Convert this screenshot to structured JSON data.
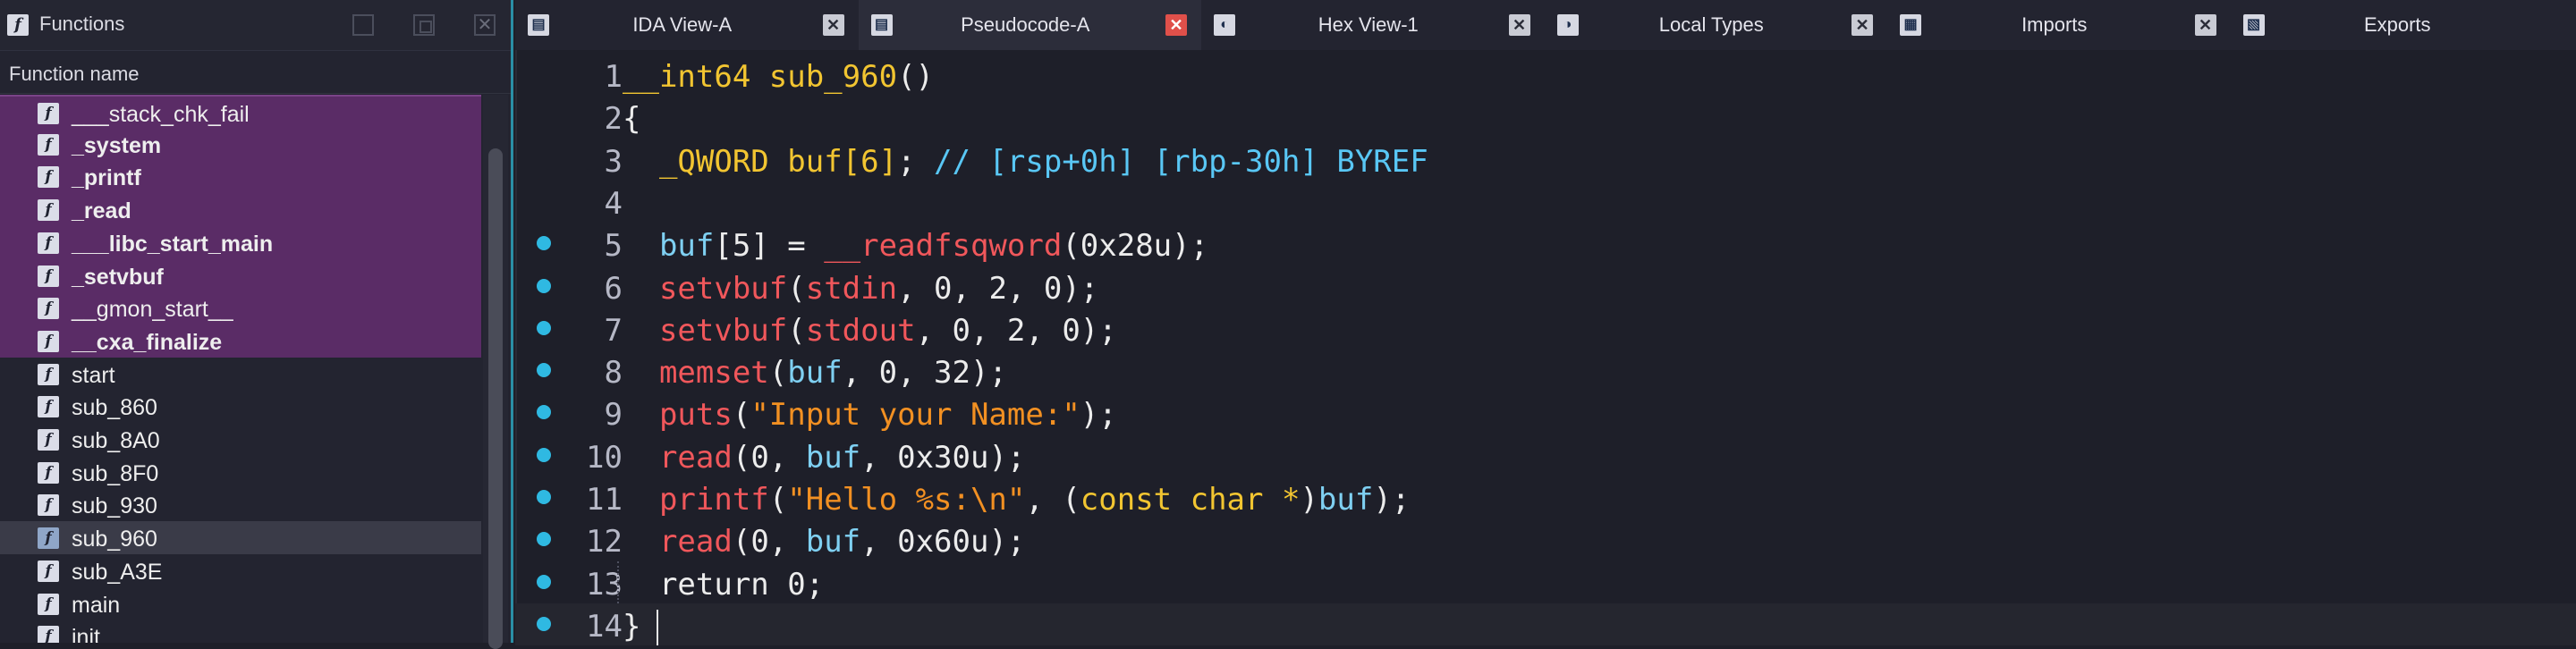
{
  "functions_panel": {
    "title": "Functions",
    "close_glyph": "✕",
    "column_header": "Function name",
    "icon_glyph": "f",
    "items": [
      {
        "name": "___stack_chk_fail",
        "imported": true,
        "bold": false
      },
      {
        "name": "_system",
        "imported": true,
        "bold": true
      },
      {
        "name": "_printf",
        "imported": true,
        "bold": true
      },
      {
        "name": "_read",
        "imported": true,
        "bold": true
      },
      {
        "name": "___libc_start_main",
        "imported": true,
        "bold": true
      },
      {
        "name": "_setvbuf",
        "imported": true,
        "bold": true
      },
      {
        "name": "__gmon_start__",
        "imported": true,
        "bold": false
      },
      {
        "name": "__cxa_finalize",
        "imported": true,
        "bold": true
      },
      {
        "name": "start",
        "imported": false,
        "bold": false
      },
      {
        "name": "sub_860",
        "imported": false,
        "bold": false
      },
      {
        "name": "sub_8A0",
        "imported": false,
        "bold": false
      },
      {
        "name": "sub_8F0",
        "imported": false,
        "bold": false
      },
      {
        "name": "sub_930",
        "imported": false,
        "bold": false
      },
      {
        "name": "sub_960",
        "imported": false,
        "bold": false,
        "selected": true
      },
      {
        "name": "sub_A3E",
        "imported": false,
        "bold": false
      },
      {
        "name": "main",
        "imported": false,
        "bold": false
      },
      {
        "name": "init",
        "imported": false,
        "bold": false
      }
    ]
  },
  "tabs": [
    {
      "label": "IDA View-A",
      "icon": "ida-view-icon",
      "close": "✕",
      "active": false
    },
    {
      "label": "Pseudocode-A",
      "icon": "pseudocode-icon",
      "close": "✕",
      "active": true
    },
    {
      "label": "Hex View-1",
      "icon": "hex-view-icon",
      "close": "✕",
      "active": false
    },
    {
      "label": "Local Types",
      "icon": "local-types-icon",
      "close": "✕",
      "active": false
    },
    {
      "label": "Imports",
      "icon": "imports-icon",
      "close": "✕",
      "active": false
    },
    {
      "label": "Exports",
      "icon": "exports-icon",
      "close": "",
      "active": false
    }
  ],
  "code": {
    "current_line": 14,
    "lines": [
      {
        "num": "1",
        "bp": false,
        "tokens": [
          [
            "kw-type",
            "__int64 "
          ],
          [
            "kw-func",
            "sub_960"
          ],
          [
            "c-plain",
            "()"
          ]
        ]
      },
      {
        "num": "2",
        "bp": false,
        "tokens": [
          [
            "c-plain",
            "{"
          ]
        ]
      },
      {
        "num": "3",
        "bp": false,
        "tokens": [
          [
            "c-plain",
            "  "
          ],
          [
            "kw-type",
            "_QWORD "
          ],
          [
            "kw-type",
            "buf[6]"
          ],
          [
            "c-plain",
            "; "
          ],
          [
            "c-cmt",
            "// [rsp+0h] [rbp-30h] BYREF"
          ]
        ]
      },
      {
        "num": "4",
        "bp": false,
        "tokens": []
      },
      {
        "num": "5",
        "bp": true,
        "tokens": [
          [
            "c-plain",
            "  "
          ],
          [
            "c-var",
            "buf"
          ],
          [
            "c-plain",
            "[5] = "
          ],
          [
            "c-call",
            "__readfsqword"
          ],
          [
            "c-plain",
            "(0x28u);"
          ]
        ]
      },
      {
        "num": "6",
        "bp": true,
        "tokens": [
          [
            "c-plain",
            "  "
          ],
          [
            "c-call",
            "setvbuf"
          ],
          [
            "c-plain",
            "("
          ],
          [
            "c-call",
            "stdin"
          ],
          [
            "c-plain",
            ", 0, 2, 0);"
          ]
        ]
      },
      {
        "num": "7",
        "bp": true,
        "tokens": [
          [
            "c-plain",
            "  "
          ],
          [
            "c-call",
            "setvbuf"
          ],
          [
            "c-plain",
            "("
          ],
          [
            "c-call",
            "stdout"
          ],
          [
            "c-plain",
            ", 0, 2, 0);"
          ]
        ]
      },
      {
        "num": "8",
        "bp": true,
        "tokens": [
          [
            "c-plain",
            "  "
          ],
          [
            "c-call",
            "memset"
          ],
          [
            "c-plain",
            "("
          ],
          [
            "c-var",
            "buf"
          ],
          [
            "c-plain",
            ", 0, 32);"
          ]
        ]
      },
      {
        "num": "9",
        "bp": true,
        "tokens": [
          [
            "c-plain",
            "  "
          ],
          [
            "c-call",
            "puts"
          ],
          [
            "c-plain",
            "("
          ],
          [
            "c-str",
            "\"Input your Name:\""
          ],
          [
            "c-plain",
            ");"
          ]
        ]
      },
      {
        "num": "10",
        "bp": true,
        "tokens": [
          [
            "c-plain",
            "  "
          ],
          [
            "c-call",
            "read"
          ],
          [
            "c-plain",
            "(0, "
          ],
          [
            "c-var",
            "buf"
          ],
          [
            "c-plain",
            ", 0x30u);"
          ]
        ]
      },
      {
        "num": "11",
        "bp": true,
        "tokens": [
          [
            "c-plain",
            "  "
          ],
          [
            "c-call",
            "printf"
          ],
          [
            "c-plain",
            "("
          ],
          [
            "c-str",
            "\"Hello %s:\\n\""
          ],
          [
            "c-plain",
            ", ("
          ],
          [
            "kw-type",
            "const char *"
          ],
          [
            "c-plain",
            ")"
          ],
          [
            "c-var",
            "buf"
          ],
          [
            "c-plain",
            ");"
          ]
        ]
      },
      {
        "num": "12",
        "bp": true,
        "tokens": [
          [
            "c-plain",
            "  "
          ],
          [
            "c-call",
            "read"
          ],
          [
            "c-plain",
            "(0, "
          ],
          [
            "c-var",
            "buf"
          ],
          [
            "c-plain",
            ", 0x60u);"
          ]
        ]
      },
      {
        "num": "13",
        "bp": true,
        "tokens": [
          [
            "c-plain",
            "  return 0;"
          ]
        ]
      },
      {
        "num": "14",
        "bp": true,
        "tokens": [
          [
            "c-plain",
            "}"
          ]
        ]
      }
    ]
  }
}
